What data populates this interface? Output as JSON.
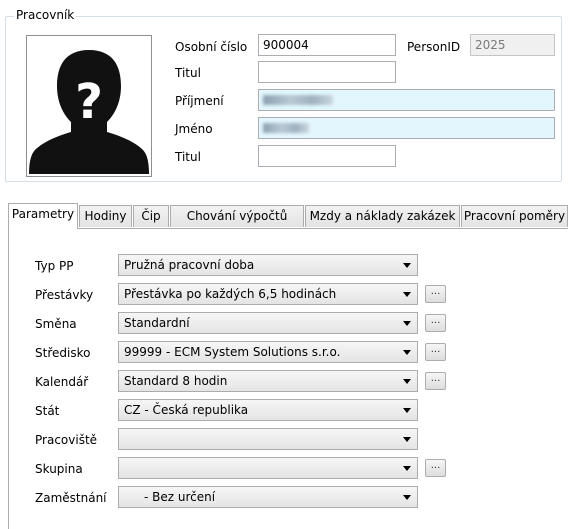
{
  "employee_group": {
    "title": "Pracovník",
    "personal_number_label": "Osobní číslo",
    "personal_number_value": "900004",
    "person_id_label": "PersonID",
    "person_id_value": "2025",
    "title_before_label": "Titul",
    "title_before_value": "",
    "surname_label": "Příjmení",
    "first_name_label": "Jméno",
    "title_after_label": "Titul",
    "title_after_value": "",
    "photo_icon": "unknown-person-silhouette-icon"
  },
  "tabs": [
    {
      "label": "Parametry",
      "active": true
    },
    {
      "label": "Hodiny"
    },
    {
      "label": "Čip"
    },
    {
      "label": "Chování výpočtů"
    },
    {
      "label": "Mzdy a náklady zakázek"
    },
    {
      "label": "Pracovní poměry"
    }
  ],
  "parameters": {
    "work_type_label": "Typ PP",
    "work_type_value": "Pružná pracovní doba",
    "breaks_label": "Přestávky",
    "breaks_value": "Přestávka po každých 6,5 hodinách",
    "shift_label": "Směna",
    "shift_value": "Standardní",
    "center_label": "Středisko",
    "center_value": "99999 - ECM System Solutions s.r.o.",
    "calendar_label": "Kalendář",
    "calendar_value": "Standard 8 hodin",
    "state_label": "Stát",
    "state_value": "CZ - Česká republika",
    "workplace_label": "Pracoviště",
    "workplace_value": "",
    "group_label": "Skupina",
    "group_value": "",
    "employment_label": "Zaměstnání",
    "employment_value": "- Bez určení",
    "browse_label": "..."
  }
}
